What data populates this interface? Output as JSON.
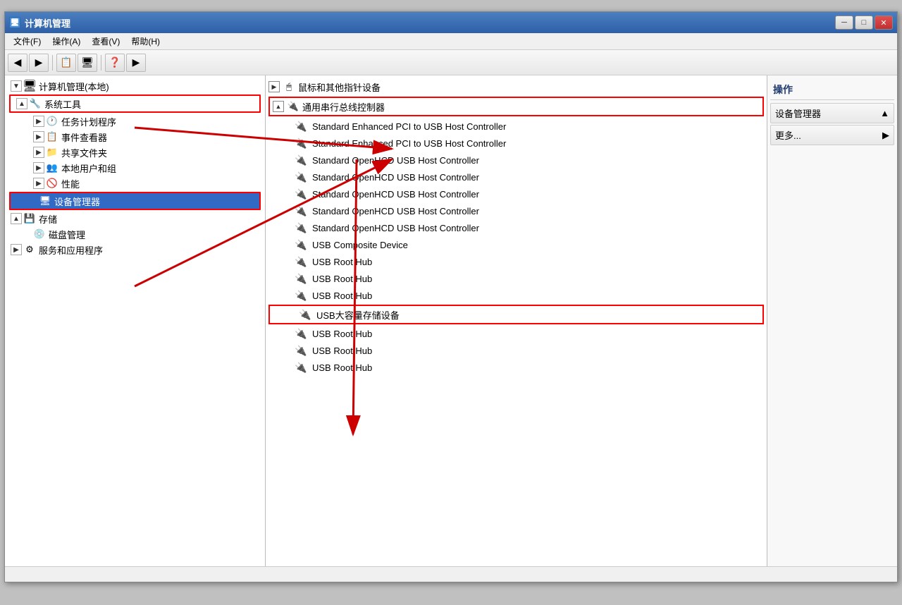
{
  "window": {
    "title": "计算机管理",
    "title_icon": "🖥",
    "min_btn": "─",
    "max_btn": "□",
    "close_btn": "✕"
  },
  "menu": {
    "items": [
      "文件(F)",
      "操作(A)",
      "查看(V)",
      "帮助(H)"
    ]
  },
  "toolbar": {
    "buttons": [
      "◀",
      "▶",
      "📋",
      "🖥",
      "❓",
      "▶"
    ]
  },
  "tree": {
    "root_label": "计算机管理(本地)",
    "items": [
      {
        "label": "系统工具",
        "indent": 1,
        "expanded": true,
        "icon": "🔧",
        "highlighted": true
      },
      {
        "label": "任务计划程序",
        "indent": 2,
        "expanded": false,
        "icon": "🕐"
      },
      {
        "label": "事件查看器",
        "indent": 2,
        "expanded": false,
        "icon": "📋"
      },
      {
        "label": "共享文件夹",
        "indent": 2,
        "expanded": false,
        "icon": "📁"
      },
      {
        "label": "本地用户和组",
        "indent": 2,
        "expanded": false,
        "icon": "👥"
      },
      {
        "label": "性能",
        "indent": 2,
        "expanded": false,
        "icon": "🚫"
      },
      {
        "label": "设备管理器",
        "indent": 2,
        "expanded": false,
        "icon": "🖥",
        "highlighted": true,
        "selected": true
      },
      {
        "label": "存储",
        "indent": 1,
        "expanded": true,
        "icon": "💾"
      },
      {
        "label": "磁盘管理",
        "indent": 2,
        "expanded": false,
        "icon": "💿"
      },
      {
        "label": "服务和应用程序",
        "indent": 1,
        "expanded": false,
        "icon": "⚙"
      }
    ]
  },
  "devices": {
    "category_label": "通用串行总线控制器",
    "category_highlighted": true,
    "items": [
      {
        "label": "Standard Enhanced PCI to USB Host Controller",
        "icon": "usb"
      },
      {
        "label": "Standard Enhanced PCI to USB Host Controller",
        "icon": "usb"
      },
      {
        "label": "Standard OpenHCD USB Host Controller",
        "icon": "usb"
      },
      {
        "label": "Standard OpenHCD USB Host Controller",
        "icon": "usb"
      },
      {
        "label": "Standard OpenHCD USB Host Controller",
        "icon": "usb"
      },
      {
        "label": "Standard OpenHCD USB Host Controller",
        "icon": "usb"
      },
      {
        "label": "Standard OpenHCD USB Host Controller",
        "icon": "usb"
      },
      {
        "label": "USB Composite Device",
        "icon": "usb"
      },
      {
        "label": "USB Root Hub",
        "icon": "usb"
      },
      {
        "label": "USB Root Hub",
        "icon": "usb"
      },
      {
        "label": "USB Root Hub",
        "icon": "usb"
      },
      {
        "label": "USB大容量存储设备",
        "icon": "usb",
        "highlighted": true
      },
      {
        "label": "USB Root Hub",
        "icon": "usb"
      },
      {
        "label": "USB Root Hub",
        "icon": "usb"
      },
      {
        "label": "USB Root Hub",
        "icon": "usb"
      }
    ],
    "other_category": "鼠标和其他指针设备"
  },
  "actions": {
    "header": "操作",
    "items": [
      {
        "label": "设备管理器",
        "has_arrow": true
      },
      {
        "label": "更多...",
        "has_arrow": true
      }
    ]
  },
  "status_bar": {
    "text": ""
  }
}
